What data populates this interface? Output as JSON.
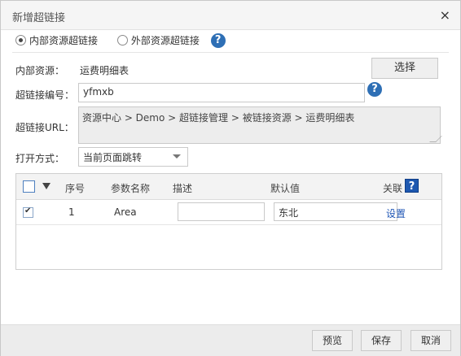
{
  "dialog": {
    "title": "新增超链接",
    "close_glyph": "×"
  },
  "link_type": {
    "options": [
      {
        "label": "内部资源超链接",
        "checked": true
      },
      {
        "label": "外部资源超链接",
        "checked": false
      }
    ],
    "help_glyph": "?"
  },
  "form": {
    "internal_resource_label": "内部资源：",
    "internal_resource_value": "运费明细表",
    "select_button": "选择",
    "code_label": "超链接编号：",
    "code_value": "yfmxb",
    "help_glyph": "?",
    "url_label": "超链接URL：",
    "url_value": "资源中心 > Demo > 超链接管理 > 被链接资源 > 运费明细表",
    "open_mode_label": "打开方式：",
    "open_mode_value": "当前页面跳转"
  },
  "params_table": {
    "headers": {
      "index": "序号",
      "name": "参数名称",
      "desc": "描述",
      "default": "默认值",
      "relation": "关联"
    },
    "relation_help_glyph": "?",
    "rows": [
      {
        "checked": true,
        "index": "1",
        "name": "Area",
        "desc": "",
        "default": "东北",
        "relation": "设置"
      }
    ]
  },
  "footer": {
    "preview": "预览",
    "save": "保存",
    "cancel": "取消"
  },
  "colors": {
    "accent": "#2e6fb5",
    "link": "#1f56b5"
  },
  "icons": [
    "close-icon",
    "radio-icon",
    "help-icon",
    "checkbox-icon",
    "dropdown-arrow-icon"
  ]
}
